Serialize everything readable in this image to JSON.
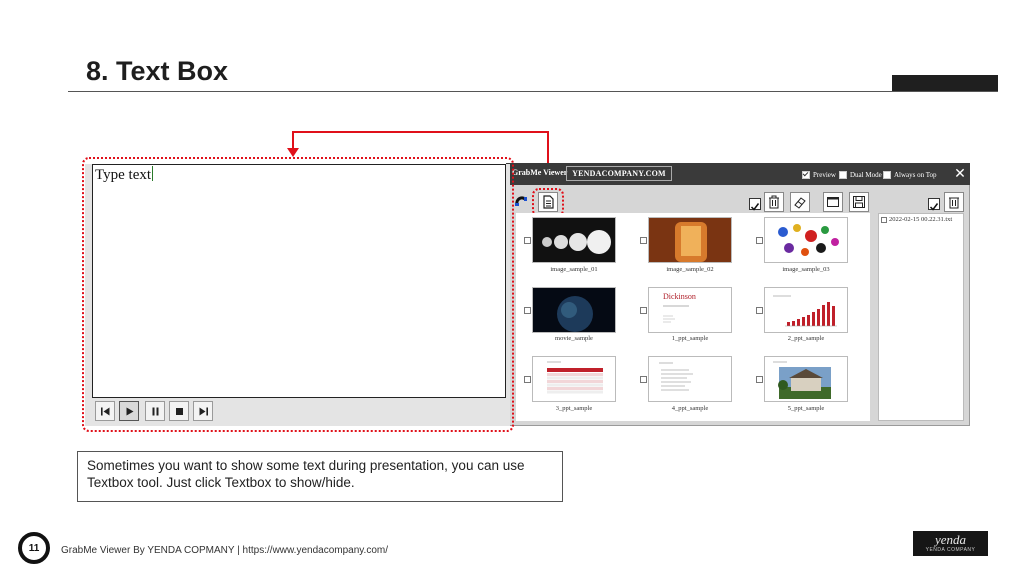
{
  "slide": {
    "title": "8. Text Box",
    "page_number": "11",
    "footer": "GrabMe Viewer By YENDA COPMANY | https://www.yendacompany.com/",
    "caption_line1": "Sometimes you want to show some text during presentation, you can use",
    "caption_line2": "Textbox tool. Just click Textbox to show/hide.",
    "logo_text": "yenda",
    "logo_subtext": "YENDA COMPANY"
  },
  "textbox_window": {
    "text": "Type text",
    "controls": [
      "first-icon",
      "play-icon",
      "pause-icon",
      "stop-icon",
      "last-icon"
    ]
  },
  "grabme_window": {
    "app_name": "GrabMe Viewer",
    "company": "YENDACOMPANY.COM",
    "options": [
      {
        "label": "Preview",
        "checked": true
      },
      {
        "label": "Dual Mode",
        "checked": false
      },
      {
        "label": "Always on Top",
        "checked": false
      }
    ],
    "close": "✕",
    "side_entry": "2022-02-15 00.22.31.txt",
    "thumbnails": [
      {
        "label": "image_sample_01",
        "kind": "spheres"
      },
      {
        "label": "image_sample_02",
        "kind": "bottle"
      },
      {
        "label": "image_sample_03",
        "kind": "splash"
      },
      {
        "label": "movie_sample",
        "kind": "earth"
      },
      {
        "label": "1_ppt_sample",
        "kind": "dickinson"
      },
      {
        "label": "2_ppt_sample",
        "kind": "barchart"
      },
      {
        "label": "3_ppt_sample",
        "kind": "table"
      },
      {
        "label": "4_ppt_sample",
        "kind": "textslide"
      },
      {
        "label": "5_ppt_sample",
        "kind": "house"
      }
    ],
    "dickinson_title": "Dickinson"
  },
  "colors": {
    "highlight": "#e0101a",
    "titlebar": "#3a3a3a",
    "title_text": "#1e1e1e"
  }
}
